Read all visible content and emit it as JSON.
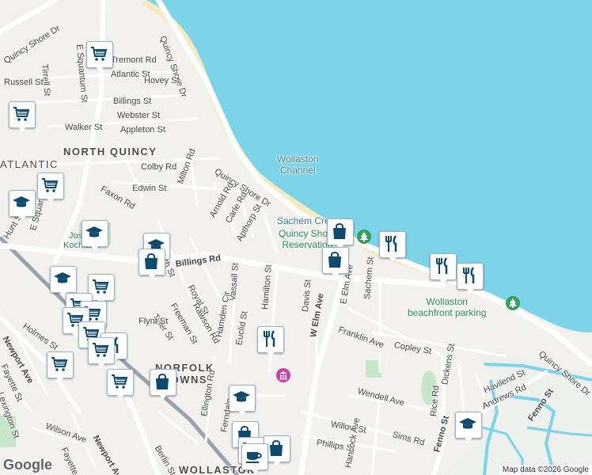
{
  "map": {
    "water_color": "#7dd3e8",
    "park_color": "#c8e6c9",
    "icon_color": "#0d4a6e"
  },
  "labels": {
    "quincy_shore_dr_n": "Quincy Shore Dr",
    "quincy_shore_dr_w": "Quincy Shore Dr",
    "quincy_shore_dr_mid": "Quincy Shore Dr",
    "quincy_shore_dr_se": "Quincy Shore Dr",
    "e_squantum_st_top": "E Squantum St",
    "e_squantum_st": "E Squantum St",
    "tirrell_st": "Tirrell St",
    "tremont_rd": "Tremont Rd",
    "atlantic_st": "Atlantic St",
    "hovey_st": "Hovey St",
    "russell_st": "Russell St",
    "billings_st": "Billings St",
    "webster_st": "Webster St",
    "appleton_st": "Appleton St",
    "walker_st": "Walker St",
    "north_quincy": "NORTH QUINCY",
    "atlantic": "ATLANTIC",
    "colby_rd": "Colby Rd",
    "milton_rd": "Milton Rd",
    "faxon_rd": "Faxon Rd",
    "edwin_st": "Edwin St",
    "arnold_rd": "Arnold Rd",
    "carle_rd": "Carle Rd",
    "apthorp_st": "Apthorp St",
    "wollaston_channel": "Wollaston\nChannel",
    "sachem_creek": "Sachem Creek",
    "quincy_shore_reservation": "Quincy Shore\nReservation",
    "hunt_st": "Hunt St",
    "josiah_kochland": "Josiah\nKochland",
    "french_st": "French St",
    "billings_rd": "Billings Rd",
    "royal_st": "Royal St",
    "rawson_rd": "Rawson Rd",
    "vassall_st": "Vassall St",
    "hamilton_st": "Hamilton St",
    "freeman_st": "Freeman St",
    "tyler_st": "Tyler St",
    "flynt_st": "Flynt St",
    "hamden_cir": "Hamden Cir",
    "euclid_st": "Euclid St",
    "davis_st": "Davis St",
    "w_elm_ave": "W Elm Ave",
    "e_elm_ave": "E Elm Ave",
    "sachem_st": "Sachem St",
    "franklin_ave": "Franklin Ave",
    "wollaston_beachfront_parking": "Wollaston\nbeachfront parking",
    "copley_st": "Copley St",
    "holmes_st": "Holmes St",
    "newport_ave_w": "Newport Ave",
    "newport_ave": "Newport Ave",
    "fayette_st_w": "Fayette St",
    "fayette_st": "Fayette St",
    "lexington_st": "Lexington St",
    "wilson_ave": "Wilson Ave",
    "norfolk_downs": "NORFOLK\nDOWNS",
    "ellington_rd": "Ellington Rd",
    "ferndale": "Ferndale",
    "berlin_st": "Berlin St",
    "wendell_ave": "Wendell Ave",
    "rice_rd": "Rice Rd",
    "dickens_st": "Dickens St",
    "havilend_st": "Havilend St",
    "andrews_rd": "Andrews Rd",
    "fenno_st": "Fenno St",
    "fenno_st_right": "Fenno St",
    "sims_rd": "Sims Rd",
    "willow_st": "Willow St",
    "phillips_st": "Phillips St",
    "wollaston": "WOLLASTON",
    "hancock_ave": "Hancock Ave"
  },
  "pins": [
    {
      "kind": "cart"
    },
    {
      "kind": "cart"
    },
    {
      "kind": "cart"
    },
    {
      "kind": "school"
    },
    {
      "kind": "school"
    },
    {
      "kind": "school"
    },
    {
      "kind": "bag"
    },
    {
      "kind": "school"
    },
    {
      "kind": "bag"
    },
    {
      "kind": "bag"
    },
    {
      "kind": "dining"
    },
    {
      "kind": "dining"
    },
    {
      "kind": "dining"
    },
    {
      "kind": "school"
    },
    {
      "kind": "cart"
    },
    {
      "kind": "cart"
    },
    {
      "kind": "cart"
    },
    {
      "kind": "cart"
    },
    {
      "kind": "cart"
    },
    {
      "kind": "dining"
    },
    {
      "kind": "cart"
    },
    {
      "kind": "cart"
    },
    {
      "kind": "cart"
    },
    {
      "kind": "bag"
    },
    {
      "kind": "dining"
    },
    {
      "kind": "school"
    },
    {
      "kind": "bag"
    },
    {
      "kind": "cart"
    },
    {
      "kind": "bag"
    },
    {
      "kind": "cafe"
    }
  ],
  "footer": {
    "google_logo": "Google",
    "attribution": "Map data ©2026 Google"
  }
}
